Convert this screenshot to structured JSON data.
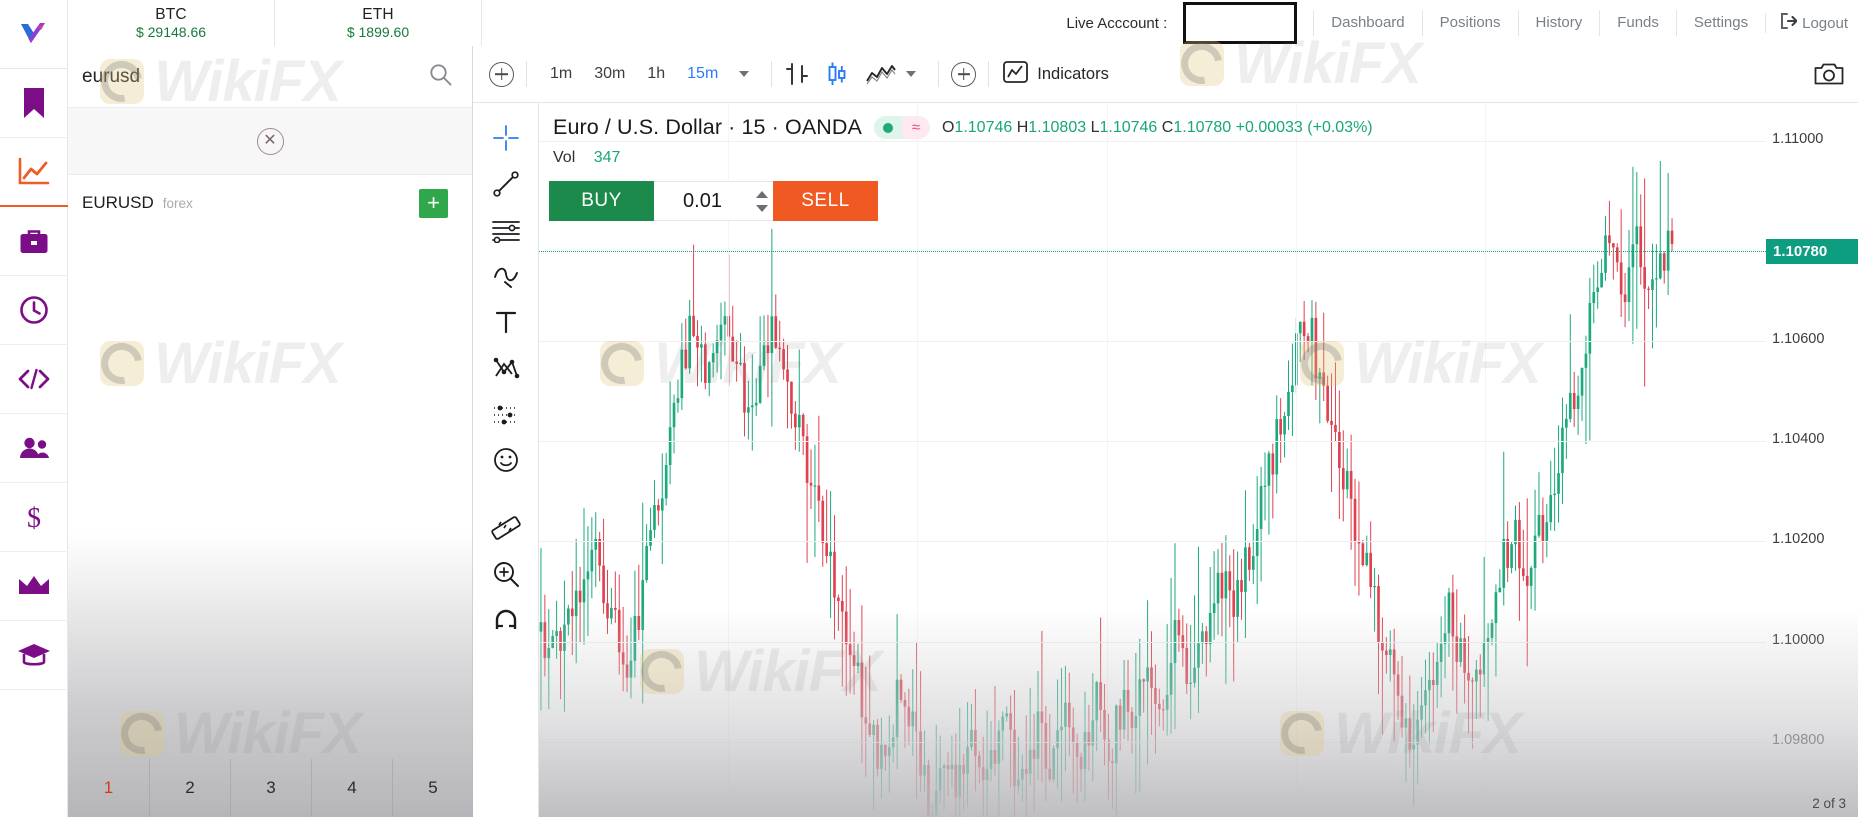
{
  "brand": {
    "logo_name": "vantage-logo"
  },
  "tickers": [
    {
      "symbol": "BTC",
      "price": "$ 29148.66"
    },
    {
      "symbol": "ETH",
      "price": "$ 1899.60"
    }
  ],
  "topnav": {
    "account_label": "Live Acccount :",
    "account_value": "",
    "links": [
      "Dashboard",
      "Positions",
      "History",
      "Funds",
      "Settings"
    ],
    "logout_label": "Logout"
  },
  "rail": {
    "items": [
      {
        "name": "bookmark-icon",
        "label": "Watchlist"
      },
      {
        "name": "chart-line-icon",
        "label": "Charts"
      },
      {
        "name": "briefcase-icon",
        "label": "Portfolio"
      },
      {
        "name": "history-clock-icon",
        "label": "History"
      },
      {
        "name": "code-icon",
        "label": "API"
      },
      {
        "name": "users-icon",
        "label": "Partners"
      },
      {
        "name": "dollar-icon",
        "label": "Funds"
      },
      {
        "name": "crown-icon",
        "label": "Premium"
      },
      {
        "name": "graduation-cap-icon",
        "label": "Education"
      }
    ]
  },
  "symbol_panel": {
    "search_value": "eurusd",
    "search_placeholder": "Search",
    "results": [
      {
        "symbol": "EURUSD",
        "type": "forex",
        "add_label": "+"
      }
    ],
    "pagination": {
      "pages": [
        "1",
        "2",
        "3",
        "4",
        "5"
      ],
      "current": "1"
    }
  },
  "chart_toolbar": {
    "timeframes": [
      "1m",
      "30m",
      "1h",
      "15m"
    ],
    "active_timeframe": "15m",
    "indicators_label": "Indicators"
  },
  "chart_legend": {
    "title": "Euro / U.S. Dollar · 15 · OANDA",
    "o_label": "O",
    "o_value": "1.10746",
    "h_label": "H",
    "h_value": "1.10803",
    "l_label": "L",
    "l_value": "1.10746",
    "c_label": "C",
    "c_value": "1.10780",
    "change": "+0.00033 (+0.03%)",
    "vol_label": "Vol",
    "vol_value": "347"
  },
  "trade_panel": {
    "buy_label": "BUY",
    "sell_label": "SELL",
    "quantity": "0.01"
  },
  "status_bar": {
    "right_text": "2 of 3"
  },
  "colors": {
    "buy_green": "#1b8a4b",
    "sell_orange": "#f05a22",
    "price_badge": "#0d9e82",
    "up_candle": "#1ba97d",
    "down_candle": "#e0414f",
    "active_tf": "#2b7cf6",
    "ticker_green": "#18793a"
  },
  "watermark": {
    "text": "WikiFX"
  },
  "chart_data": {
    "type": "candlestick",
    "title": "Euro / U.S. Dollar · 15 · OANDA",
    "symbol": "EURUSD",
    "exchange": "OANDA",
    "interval": "15",
    "ylabel": "",
    "xlabel": "",
    "ylim": [
      1.0965,
      1.11075
    ],
    "y_ticks": [
      "1.11000",
      "1.10600",
      "1.10400",
      "1.10200",
      "1.10000",
      "1.09800"
    ],
    "y_tick_values": [
      1.11,
      1.106,
      1.104,
      1.102,
      1.1,
      1.098
    ],
    "current_price": 1.1078,
    "current_price_label": "1.10780",
    "grid": true,
    "legend_position": "top-left",
    "ohlc_last": {
      "open": 1.10746,
      "high": 1.10803,
      "low": 1.10746,
      "close": 1.1078,
      "volume": 347
    },
    "closes": [
      1.1002,
      1.1,
      1.0998,
      1.1004,
      1.1011,
      1.1007,
      1.1013,
      1.102,
      1.1016,
      1.101,
      1.1006,
      1.1,
      1.0996,
      1.1002,
      1.101,
      1.1018,
      1.1026,
      1.1034,
      1.1042,
      1.105,
      1.1058,
      1.1064,
      1.106,
      1.1054,
      1.106,
      1.1066,
      1.1062,
      1.1056,
      1.105,
      1.1044,
      1.105,
      1.1056,
      1.1062,
      1.1058,
      1.1052,
      1.1046,
      1.104,
      1.1034,
      1.1028,
      1.1022,
      1.1016,
      1.101,
      1.1004,
      1.0998,
      1.0992,
      1.0986,
      1.098,
      1.0974,
      1.098,
      1.0986,
      1.0992,
      1.0986,
      1.098,
      1.0974,
      1.0968,
      1.0974,
      1.098,
      1.0975,
      1.097,
      1.0976,
      1.0982,
      1.0978,
      1.0972,
      1.0978,
      1.0984,
      1.098,
      1.0974,
      1.097,
      1.0976,
      1.0982,
      1.0978,
      1.0974,
      1.098,
      1.0986,
      1.0982,
      1.0976,
      1.0982,
      1.0988,
      1.0984,
      1.0978,
      1.0984,
      1.099,
      1.0986,
      1.0992,
      1.0998,
      1.0994,
      1.0988,
      1.0994,
      1.1,
      1.0996,
      1.099,
      1.0996,
      1.1002,
      1.1008,
      1.1014,
      1.101,
      1.1004,
      1.101,
      1.1016,
      1.1022,
      1.1028,
      1.1034,
      1.104,
      1.1046,
      1.1052,
      1.1058,
      1.1064,
      1.106,
      1.1054,
      1.1048,
      1.1042,
      1.1036,
      1.103,
      1.1024,
      1.1018,
      1.1012,
      1.1006,
      1.1,
      1.0994,
      1.0988,
      1.0982,
      1.0976,
      1.0982,
      1.0988,
      1.0994,
      1.1,
      1.1006,
      1.1,
      1.0994,
      1.0988,
      1.0994,
      1.1,
      1.1006,
      1.1012,
      1.1018,
      1.1024,
      1.1018,
      1.1012,
      1.1018,
      1.1024,
      1.103,
      1.1036,
      1.1042,
      1.1048,
      1.1054,
      1.106,
      1.1066,
      1.1072,
      1.1078,
      1.1074,
      1.1068,
      1.1074,
      1.108,
      1.1076,
      1.107,
      1.1076,
      1.1078,
      1.1078
    ]
  }
}
